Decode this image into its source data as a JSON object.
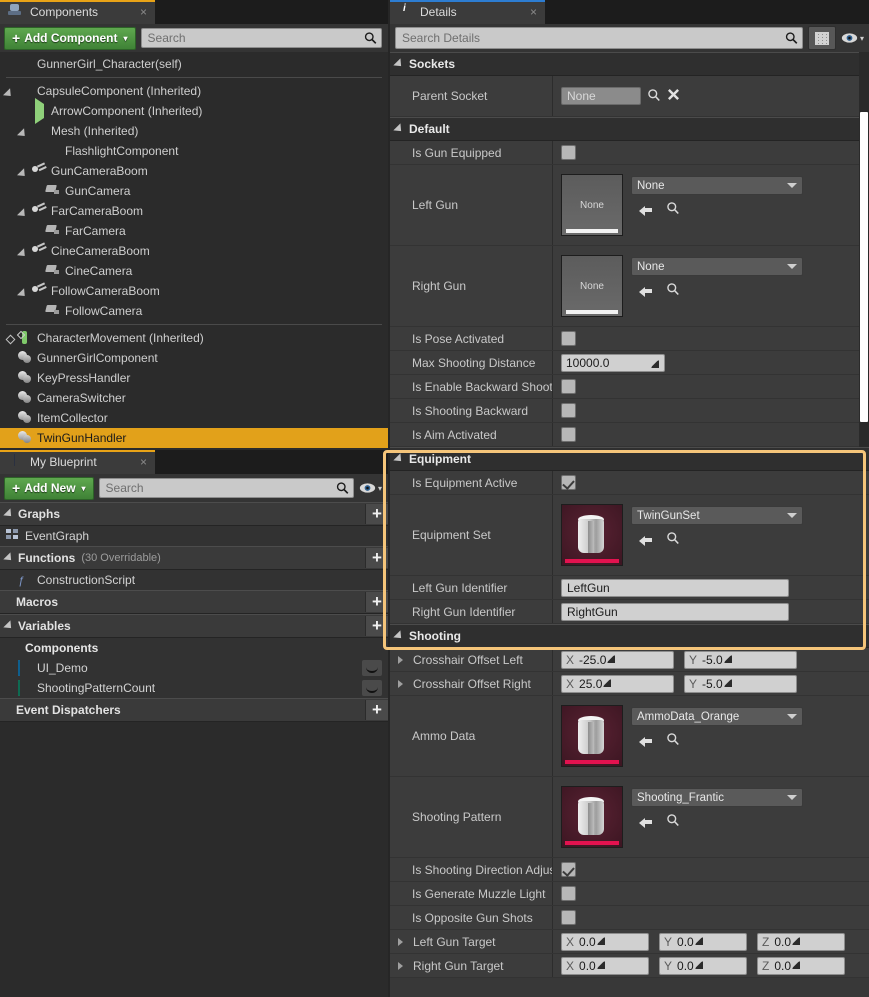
{
  "app": {
    "accent_highlight": "#f5c57a",
    "selection_color": "#e2a11a",
    "components_tab_accent": "#e8a317",
    "details_tab_accent": "#2d7dd2"
  },
  "components_panel": {
    "tab": {
      "label": "Components",
      "icon": "components-icon",
      "close": "×"
    },
    "add_button": {
      "label": "Add Component",
      "plus": "+",
      "caret": "▾"
    },
    "search": {
      "placeholder": "Search",
      "icon": "search-icon"
    },
    "tree": [
      {
        "label": "GunnerGirl_Character(self)",
        "indent": 0,
        "arrow": "none",
        "icon": "self-icon",
        "selected": false,
        "separator_after": true
      },
      {
        "label": "CapsuleComponent (Inherited)",
        "indent": 0,
        "arrow": "down",
        "icon": "capsule-icon",
        "selected": false
      },
      {
        "label": "ArrowComponent (Inherited)",
        "indent": 1,
        "arrow": "none",
        "icon": "arrow-component-icon",
        "selected": false
      },
      {
        "label": "Mesh (Inherited)",
        "indent": 1,
        "arrow": "down",
        "icon": "mesh-icon",
        "selected": false
      },
      {
        "label": "FlashlightComponent",
        "indent": 2,
        "arrow": "none",
        "icon": "light-icon",
        "selected": false
      },
      {
        "label": "GunCameraBoom",
        "indent": 1,
        "arrow": "down",
        "icon": "spring-arm-icon",
        "selected": false
      },
      {
        "label": "GunCamera",
        "indent": 2,
        "arrow": "none",
        "icon": "camera-icon",
        "selected": false
      },
      {
        "label": "FarCameraBoom",
        "indent": 1,
        "arrow": "down",
        "icon": "spring-arm-icon",
        "selected": false
      },
      {
        "label": "FarCamera",
        "indent": 2,
        "arrow": "none",
        "icon": "camera-icon",
        "selected": false
      },
      {
        "label": "CineCameraBoom",
        "indent": 1,
        "arrow": "down",
        "icon": "spring-arm-icon",
        "selected": false
      },
      {
        "label": "CineCamera",
        "indent": 2,
        "arrow": "none",
        "icon": "camera-icon",
        "selected": false
      },
      {
        "label": "FollowCameraBoom",
        "indent": 1,
        "arrow": "down",
        "icon": "spring-arm-icon",
        "selected": false
      },
      {
        "label": "FollowCamera",
        "indent": 2,
        "arrow": "none",
        "icon": "camera-icon",
        "selected": false,
        "separator_after": true
      },
      {
        "label": "CharacterMovement (Inherited)",
        "indent": 0,
        "arrow": "diamond",
        "icon": "character-movement-icon",
        "selected": false
      },
      {
        "label": "GunnerGirlComponent",
        "indent": 0,
        "arrow": "none",
        "icon": "actor-component-icon",
        "selected": false
      },
      {
        "label": "KeyPressHandler",
        "indent": 0,
        "arrow": "none",
        "icon": "actor-component-icon",
        "selected": false
      },
      {
        "label": "CameraSwitcher",
        "indent": 0,
        "arrow": "none",
        "icon": "actor-component-icon",
        "selected": false
      },
      {
        "label": "ItemCollector",
        "indent": 0,
        "arrow": "none",
        "icon": "actor-component-icon",
        "selected": false
      },
      {
        "label": "TwinGunHandler",
        "indent": 0,
        "arrow": "none",
        "icon": "actor-component-icon",
        "selected": true
      }
    ]
  },
  "my_blueprint_panel": {
    "tab": {
      "label": "My Blueprint",
      "icon": "blueprint-book-icon",
      "close": "×"
    },
    "add_button": {
      "label": "Add New",
      "plus": "+",
      "caret": "▾"
    },
    "search": {
      "placeholder": "Search",
      "icon": "search-icon"
    },
    "eye_button": {
      "icon": "eye-icon",
      "caret": "▾"
    },
    "sections": [
      {
        "title": "Graphs",
        "suffix": "",
        "collapsible": true,
        "add": "+",
        "items": [
          {
            "label": "EventGraph",
            "icon": "event-graph-icon",
            "arrow": "right",
            "bold": false
          }
        ]
      },
      {
        "title": "Functions",
        "suffix": "(30 Overridable)",
        "collapsible": true,
        "add": "+",
        "items": [
          {
            "label": "ConstructionScript",
            "icon": "function-icon",
            "arrow": "none",
            "bold": false
          }
        ]
      },
      {
        "title": "Macros",
        "suffix": "",
        "collapsible": false,
        "add": "+",
        "items": []
      },
      {
        "title": "Variables",
        "suffix": "",
        "collapsible": true,
        "add": "+",
        "items": [
          {
            "label": "Components",
            "icon": "none",
            "arrow": "right",
            "bold": true
          },
          {
            "label": "UI_Demo",
            "icon": "var-object-icon",
            "arrow": "none",
            "bold": false,
            "eye": true
          },
          {
            "label": "ShootingPatternCount",
            "icon": "var-int-icon",
            "arrow": "none",
            "bold": false,
            "eye": true
          }
        ]
      },
      {
        "title": "Event Dispatchers",
        "suffix": "",
        "collapsible": false,
        "add": "+",
        "items": []
      }
    ]
  },
  "details_panel": {
    "tab": {
      "label": "Details",
      "icon": "details-info-icon",
      "close": "×"
    },
    "search": {
      "placeholder": "Search Details",
      "icon": "search-icon"
    },
    "grid_button": {
      "icon": "grid-view-icon"
    },
    "eye_button": {
      "icon": "eye-icon",
      "caret": "▾"
    },
    "categories": [
      {
        "name": "Sockets",
        "highlighted": false,
        "rows": [
          {
            "type": "socket",
            "label": "Parent Socket",
            "value": "None",
            "icons": [
              "browse-icon",
              "clear-icon"
            ]
          }
        ]
      },
      {
        "name": "Default",
        "highlighted": false,
        "rows": [
          {
            "type": "checkbox",
            "label": "Is Gun Equipped",
            "checked": false
          },
          {
            "type": "asset",
            "label": "Left Gun",
            "thumb": "none",
            "thumb_caption": "None",
            "value": "None"
          },
          {
            "type": "asset",
            "label": "Right Gun",
            "thumb": "none",
            "thumb_caption": "None",
            "value": "None"
          },
          {
            "type": "checkbox",
            "label": "Is Pose Activated",
            "checked": false
          },
          {
            "type": "number",
            "label": "Max Shooting Distance",
            "value": "10000.0"
          },
          {
            "type": "checkbox",
            "label": "Is Enable Backward Shooting",
            "checked": false
          },
          {
            "type": "checkbox",
            "label": "Is Shooting Backward",
            "checked": false
          },
          {
            "type": "checkbox",
            "label": "Is Aim Activated",
            "checked": false
          }
        ]
      },
      {
        "name": "Equipment",
        "highlighted": true,
        "rows": [
          {
            "type": "checkbox",
            "label": "Is Equipment Active",
            "checked": true
          },
          {
            "type": "asset",
            "label": "Equipment Set",
            "thumb": "asset",
            "thumb_caption": "",
            "value": "TwinGunSet"
          },
          {
            "type": "text",
            "label": "Left Gun Identifier",
            "value": "LeftGun"
          },
          {
            "type": "text",
            "label": "Right Gun Identifier",
            "value": "RightGun"
          }
        ]
      },
      {
        "name": "Shooting",
        "highlighted": false,
        "rows": [
          {
            "type": "vector2",
            "label": "Crosshair Offset Left",
            "expandable": true,
            "x": "-25.0",
            "y": "-5.0"
          },
          {
            "type": "vector2",
            "label": "Crosshair Offset Right",
            "expandable": true,
            "x": "25.0",
            "y": "-5.0"
          },
          {
            "type": "asset",
            "label": "Ammo Data",
            "thumb": "asset",
            "thumb_caption": "",
            "value": "AmmoData_Orange"
          },
          {
            "type": "asset",
            "label": "Shooting Pattern",
            "thumb": "asset",
            "thumb_caption": "",
            "value": "Shooting_Frantic"
          },
          {
            "type": "checkbox",
            "label": "Is Shooting Direction Adjusted",
            "checked": true
          },
          {
            "type": "checkbox",
            "label": "Is Generate Muzzle Light",
            "checked": false
          },
          {
            "type": "checkbox",
            "label": "Is Opposite Gun Shots",
            "checked": false
          },
          {
            "type": "vector3",
            "label": "Left Gun Target",
            "expandable": true,
            "x": "0.0",
            "y": "0.0",
            "z": "0.0"
          },
          {
            "type": "vector3",
            "label": "Right Gun Target",
            "expandable": true,
            "x": "0.0",
            "y": "0.0",
            "z": "0.0"
          }
        ]
      }
    ],
    "axis_labels": {
      "x": "X",
      "y": "Y",
      "z": "Z"
    }
  }
}
